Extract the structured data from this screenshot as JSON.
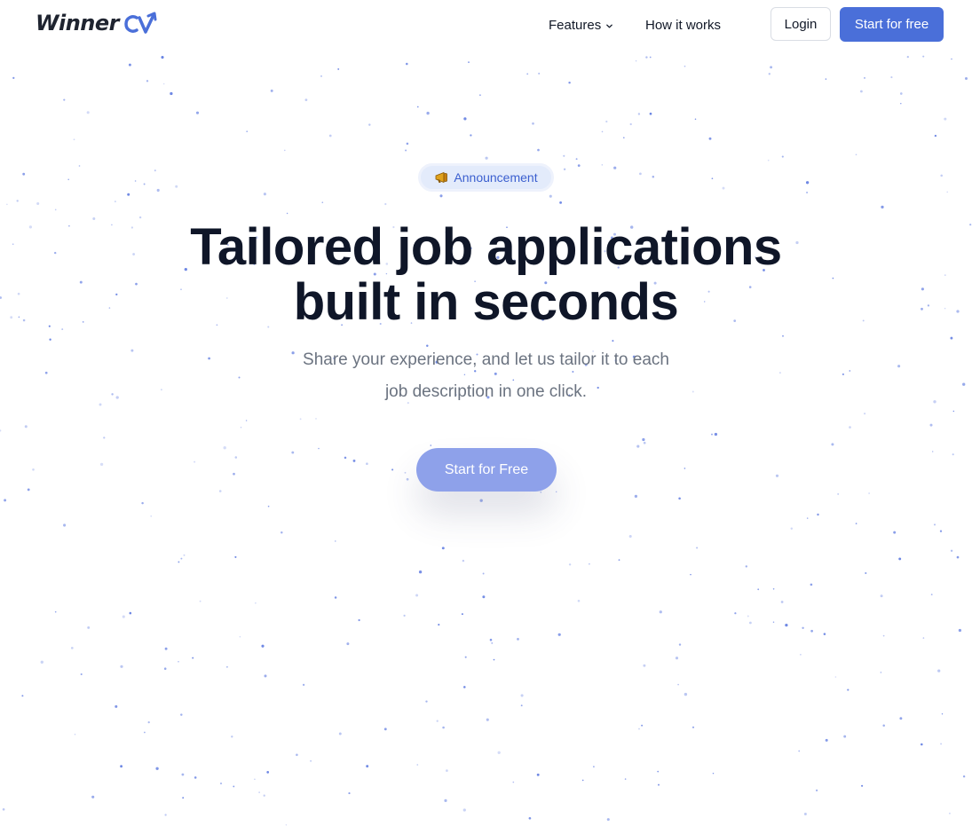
{
  "brand": {
    "name": "Winner",
    "mark": "CV",
    "color": "#4a6fd9"
  },
  "nav": {
    "features_label": "Features",
    "how_label": "How it works",
    "login_label": "Login",
    "start_label": "Start for free"
  },
  "hero": {
    "badge_label": "Announcement",
    "badge_icon": "megaphone-icon",
    "title_line1": "Tailored job applications",
    "title_line2": "built in seconds",
    "subtitle_line1": "Share your experience, and let us tailor it to each",
    "subtitle_line2": "job description in one click.",
    "cta_label": "Start for Free"
  },
  "colors": {
    "accent": "#4a6fd9",
    "cta": "#8ea1ea",
    "badge_bg": "#e3ebfb",
    "headline": "#0f1628",
    "subtitle": "#6b7380",
    "particles": "#5b78e0"
  }
}
